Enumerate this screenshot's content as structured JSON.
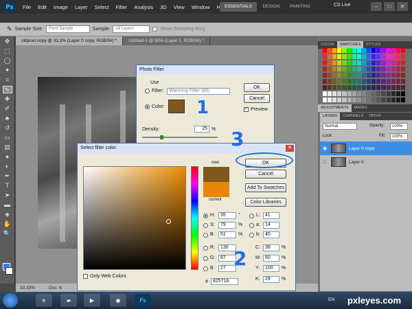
{
  "app": {
    "logo": "Ps",
    "menu": [
      "File",
      "Edit",
      "Image",
      "Layer",
      "Select",
      "Filter",
      "Analysis",
      "3D",
      "View",
      "Window",
      "Help"
    ],
    "workspaces": [
      "ESSENTIALS",
      "DESIGN",
      "PAINTING"
    ],
    "cs_live": "CS Live"
  },
  "options": {
    "sample_size_label": "Sample Size:",
    "sample_size_value": "Point Sample",
    "sample_label": "Sample:",
    "sample_value": "All Layers",
    "show_ring_label": "Show Sampling Ring"
  },
  "doc_tabs": [
    "oldpool copy @ 33,3% (Layer 0 copy, RGB/8#) *",
    "Untitled-1 @ 50% (Layer 1, RGB/8#) *"
  ],
  "status": {
    "zoom": "33.33%",
    "doc": "Doc: 6"
  },
  "panels": {
    "color_tabs": [
      "COLOR",
      "SWATCHES",
      "STYLES"
    ],
    "adj_tabs": [
      "ADJUSTMENTS",
      "MASKS"
    ],
    "layer_tabs": [
      "LAYERS",
      "CHANNELS",
      "PATHS"
    ],
    "blend_mode": "Normal",
    "opacity_label": "Opacity:",
    "opacity_value": "100%",
    "lock_label": "Lock:",
    "fill_label": "Fill:",
    "fill_value": "100%",
    "layers": [
      "Layer 0 copy",
      "Layer 0"
    ]
  },
  "photo_filter": {
    "title": "Photo Filter",
    "use_label": "Use",
    "filter_label": "Filter:",
    "filter_value": "Warming Filter (85)",
    "color_label": "Color:",
    "density_label": "Density:",
    "density_value": "25",
    "density_unit": "%",
    "ok": "OK",
    "cancel": "Cancel",
    "preview": "Preview",
    "color_hex": "#82571b"
  },
  "color_picker": {
    "title": "Select filter color:",
    "new_label": "new",
    "current_label": "current",
    "ok": "OK",
    "cancel": "Cancel",
    "add_to_swatches": "Add To Swatches",
    "color_libraries": "Color Libraries",
    "only_web": "Only Web Colors",
    "H": "35",
    "S": "79",
    "B": "51",
    "R": "130",
    "G": "87",
    "Bv": "27",
    "L": "41",
    "a": "14",
    "b": "40",
    "C": "38",
    "M": "60",
    "Y": "100",
    "K": "29",
    "hex": "82571b",
    "deg": "°",
    "pct": "%",
    "new_color": "#82571b",
    "current_color": "#e6870c"
  },
  "annotations": [
    "1",
    "2",
    "3"
  ],
  "taskbar": {
    "lang": "EN",
    "watermark": "pxleyes.com"
  }
}
